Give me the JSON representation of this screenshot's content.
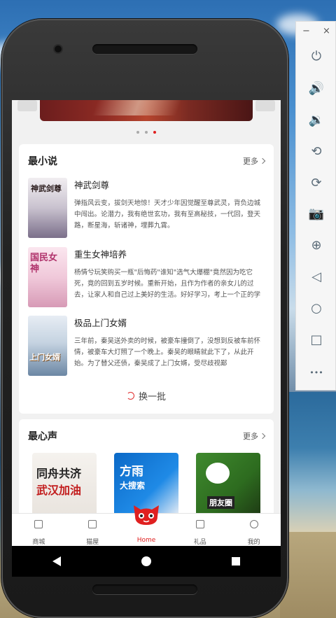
{
  "emulator": {
    "minimize_label": "−",
    "close_label": "×",
    "buttons": [
      "power-icon",
      "volume-up-icon",
      "volume-down-icon",
      "rotate-left-icon",
      "rotate-right-icon",
      "camera-icon",
      "zoom-icon",
      "back-icon",
      "home-icon",
      "overview-icon",
      "more-icon"
    ],
    "more_label": "•••"
  },
  "banner": {
    "active_dot": 2,
    "dot_count": 3
  },
  "novels": {
    "title": "最小说",
    "more_label": "更多",
    "books": [
      {
        "title": "神武剑尊",
        "cover_text": "神武剑尊",
        "desc": "弹指风云变，拔剑天地惊！天才少年因觉醒至尊武灵，背负边城中闯出。论潜力，我有绝世玄功，我有至高秘技，一代回，登天路，断星海，斩诸神，埋葬九霄。"
      },
      {
        "title": "重生女神培养",
        "cover_text": "国民女神",
        "desc": "杨情兮玩笑购买一瓶\"后悔药\"谁知\"选气大爆棚\"竟然因为吃它死，竟的回到五岁时候。重新开始，且作为作者的亲女儿的过去，让家人和自己过上美好的生活。好好学习，考上一个正的学霸发展。"
      },
      {
        "title": "极品上门女婿",
        "cover_text": "上门女婿",
        "desc": "三年前，秦吴送外卖的时候，被豪车撞倒了，没想到反被车前怀情，被豪车大灯照了一个晚上。秦吴的眼睛就此下了，从此开始。为了替父还债，秦吴成了上门女婿，受尽歧视鄙"
      }
    ],
    "refresh_label": "换一批"
  },
  "voices": {
    "title": "最心声",
    "more_label": "更多",
    "items": [
      {
        "line1": "同舟共济",
        "line2": "武汉加油"
      },
      {
        "line1": "方雨",
        "line2": "大搜索"
      },
      {
        "line1": "朋友圈"
      }
    ]
  },
  "tabbar": {
    "items": [
      {
        "label": "商城"
      },
      {
        "label": "猫屋"
      },
      {
        "label": "Home"
      },
      {
        "label": "礼品"
      },
      {
        "label": "我的"
      }
    ]
  },
  "colors": {
    "accent": "#e02020",
    "nav_bg": "#000000"
  }
}
